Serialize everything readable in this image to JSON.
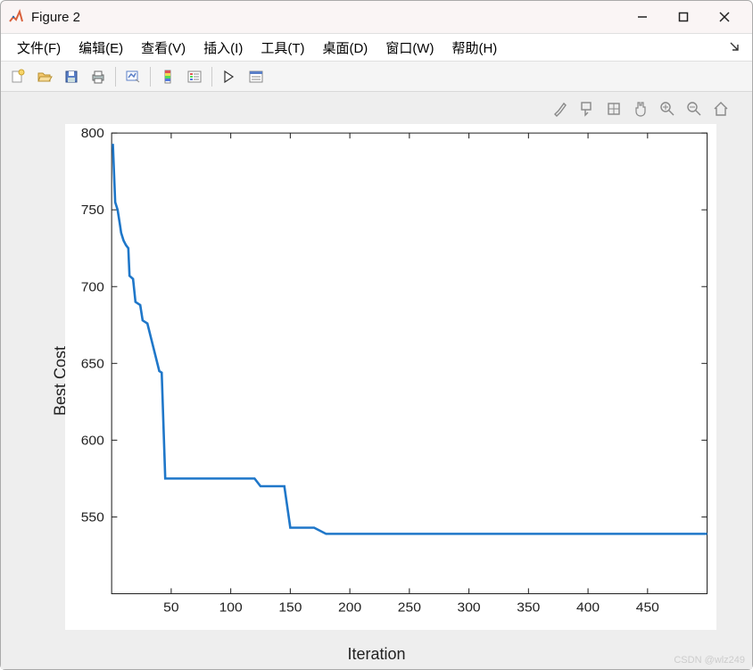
{
  "window": {
    "title": "Figure 2"
  },
  "menu": {
    "file": "文件(F)",
    "edit": "编辑(E)",
    "view": "查看(V)",
    "insert": "插入(I)",
    "tools": "工具(T)",
    "desktop": "桌面(D)",
    "window": "窗口(W)",
    "help": "帮助(H)"
  },
  "axis": {
    "xlabel": "Iteration",
    "ylabel": "Best Cost"
  },
  "watermark": "CSDN @wlz249",
  "chart_data": {
    "type": "line",
    "title": "",
    "xlabel": "Iteration",
    "ylabel": "Best Cost",
    "xlim": [
      0,
      500
    ],
    "ylim": [
      500,
      800
    ],
    "xticks": [
      50,
      100,
      150,
      200,
      250,
      300,
      350,
      400,
      450
    ],
    "yticks": [
      550,
      600,
      650,
      700,
      750,
      800
    ],
    "x": [
      1,
      3,
      5,
      7,
      8,
      10,
      12,
      14,
      15,
      18,
      20,
      24,
      26,
      30,
      40,
      42,
      45,
      120,
      125,
      145,
      150,
      170,
      180,
      500
    ],
    "values": [
      793,
      755,
      750,
      740,
      735,
      730,
      727,
      725,
      707,
      705,
      690,
      688,
      678,
      676,
      645,
      644,
      575,
      575,
      570,
      570,
      543,
      543,
      539,
      539
    ]
  }
}
